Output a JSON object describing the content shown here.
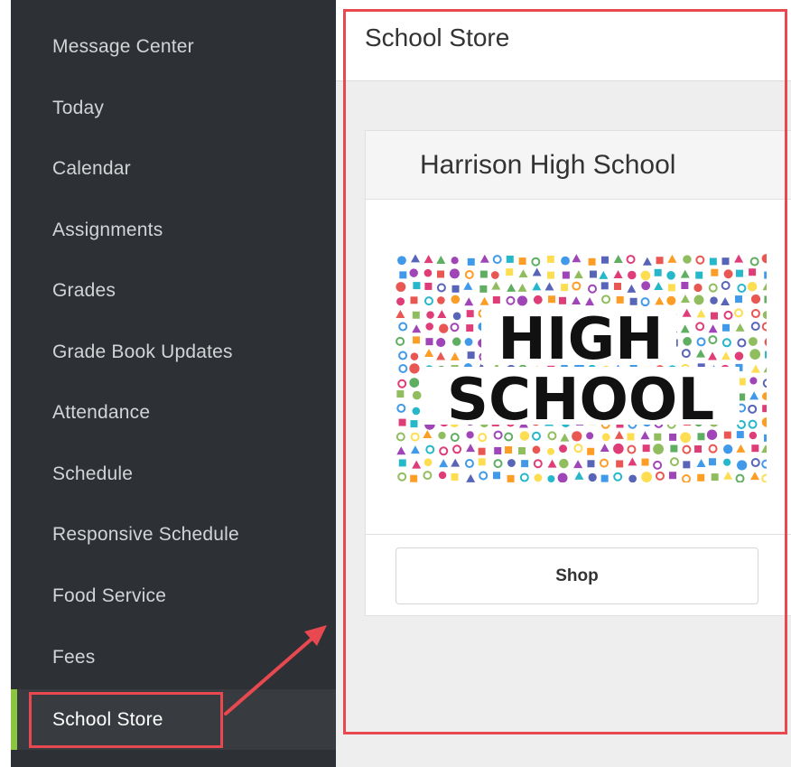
{
  "sidebar": {
    "items": [
      {
        "label": "Message Center",
        "active": false
      },
      {
        "label": "Today",
        "active": false
      },
      {
        "label": "Calendar",
        "active": false
      },
      {
        "label": "Assignments",
        "active": false
      },
      {
        "label": "Grades",
        "active": false
      },
      {
        "label": "Grade Book Updates",
        "active": false
      },
      {
        "label": "Attendance",
        "active": false
      },
      {
        "label": "Schedule",
        "active": false
      },
      {
        "label": "Responsive Schedule",
        "active": false
      },
      {
        "label": "Food Service",
        "active": false
      },
      {
        "label": "Fees",
        "active": false
      },
      {
        "label": "School Store",
        "active": true
      }
    ]
  },
  "main": {
    "title": "School Store",
    "store": {
      "school_name": "Harrison High School",
      "image": {
        "line1": "HIGH",
        "line2": "SCHOOL",
        "style": "education icon collage"
      },
      "shop_label": "Shop"
    }
  },
  "annotation": {
    "color": "#e8484f"
  },
  "colors": {
    "sidebar_bg": "#2d3034",
    "sidebar_active_bg": "#383c41",
    "active_indicator": "#8cc640",
    "main_bg": "#eeeeee"
  }
}
